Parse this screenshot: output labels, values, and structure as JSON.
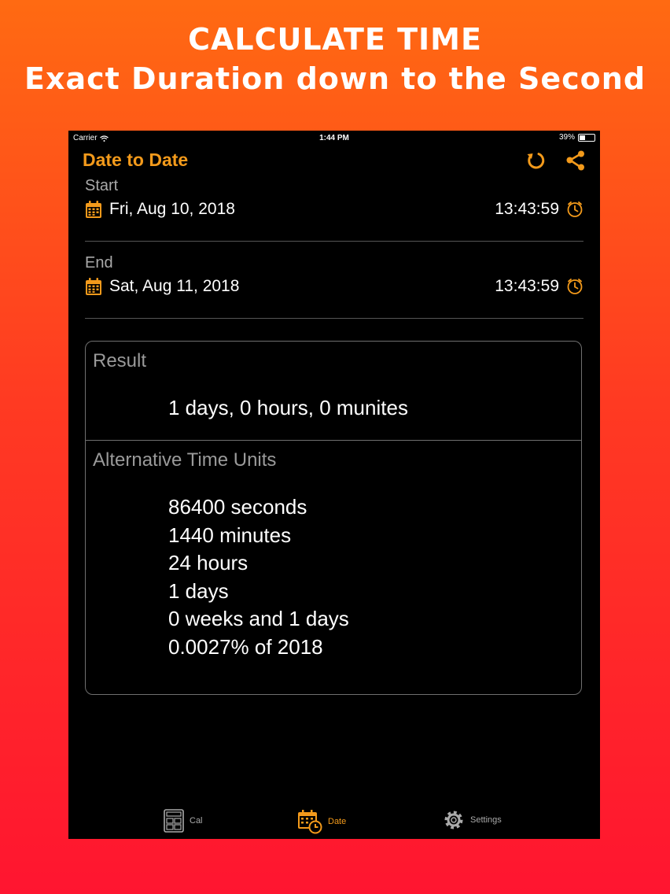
{
  "promo": {
    "line1": "CALCULATE TIME",
    "line2": "Exact Duration down to the Second"
  },
  "status_bar": {
    "carrier": "Carrier",
    "time": "1:44 PM",
    "battery": "39%",
    "battery_level": 0.39
  },
  "nav": {
    "title": "Date to Date"
  },
  "start": {
    "label": "Start",
    "date": "Fri, Aug 10, 2018",
    "time": "13:43:59"
  },
  "end": {
    "label": "End",
    "date": "Sat, Aug 11, 2018",
    "time": "13:43:59"
  },
  "result": {
    "title": "Result",
    "value": "1 days, 0 hours, 0 munites"
  },
  "alternative": {
    "title": "Alternative Time Units",
    "items": [
      "86400 seconds",
      "1440 minutes",
      "24 hours",
      "1 days",
      "0 weeks and 1 days",
      "0.0027% of 2018"
    ]
  },
  "tabs": [
    {
      "label": "Cal",
      "icon": "calculator-icon",
      "active": false
    },
    {
      "label": "Date",
      "icon": "calendar-clock-icon",
      "active": true
    },
    {
      "label": "Settings",
      "icon": "gear-icon",
      "active": false
    }
  ],
  "colors": {
    "accent": "#f39a1b",
    "background": "#000000",
    "promo_gradient_top": "#ff6a12",
    "promo_gradient_bottom": "#ff1530"
  }
}
